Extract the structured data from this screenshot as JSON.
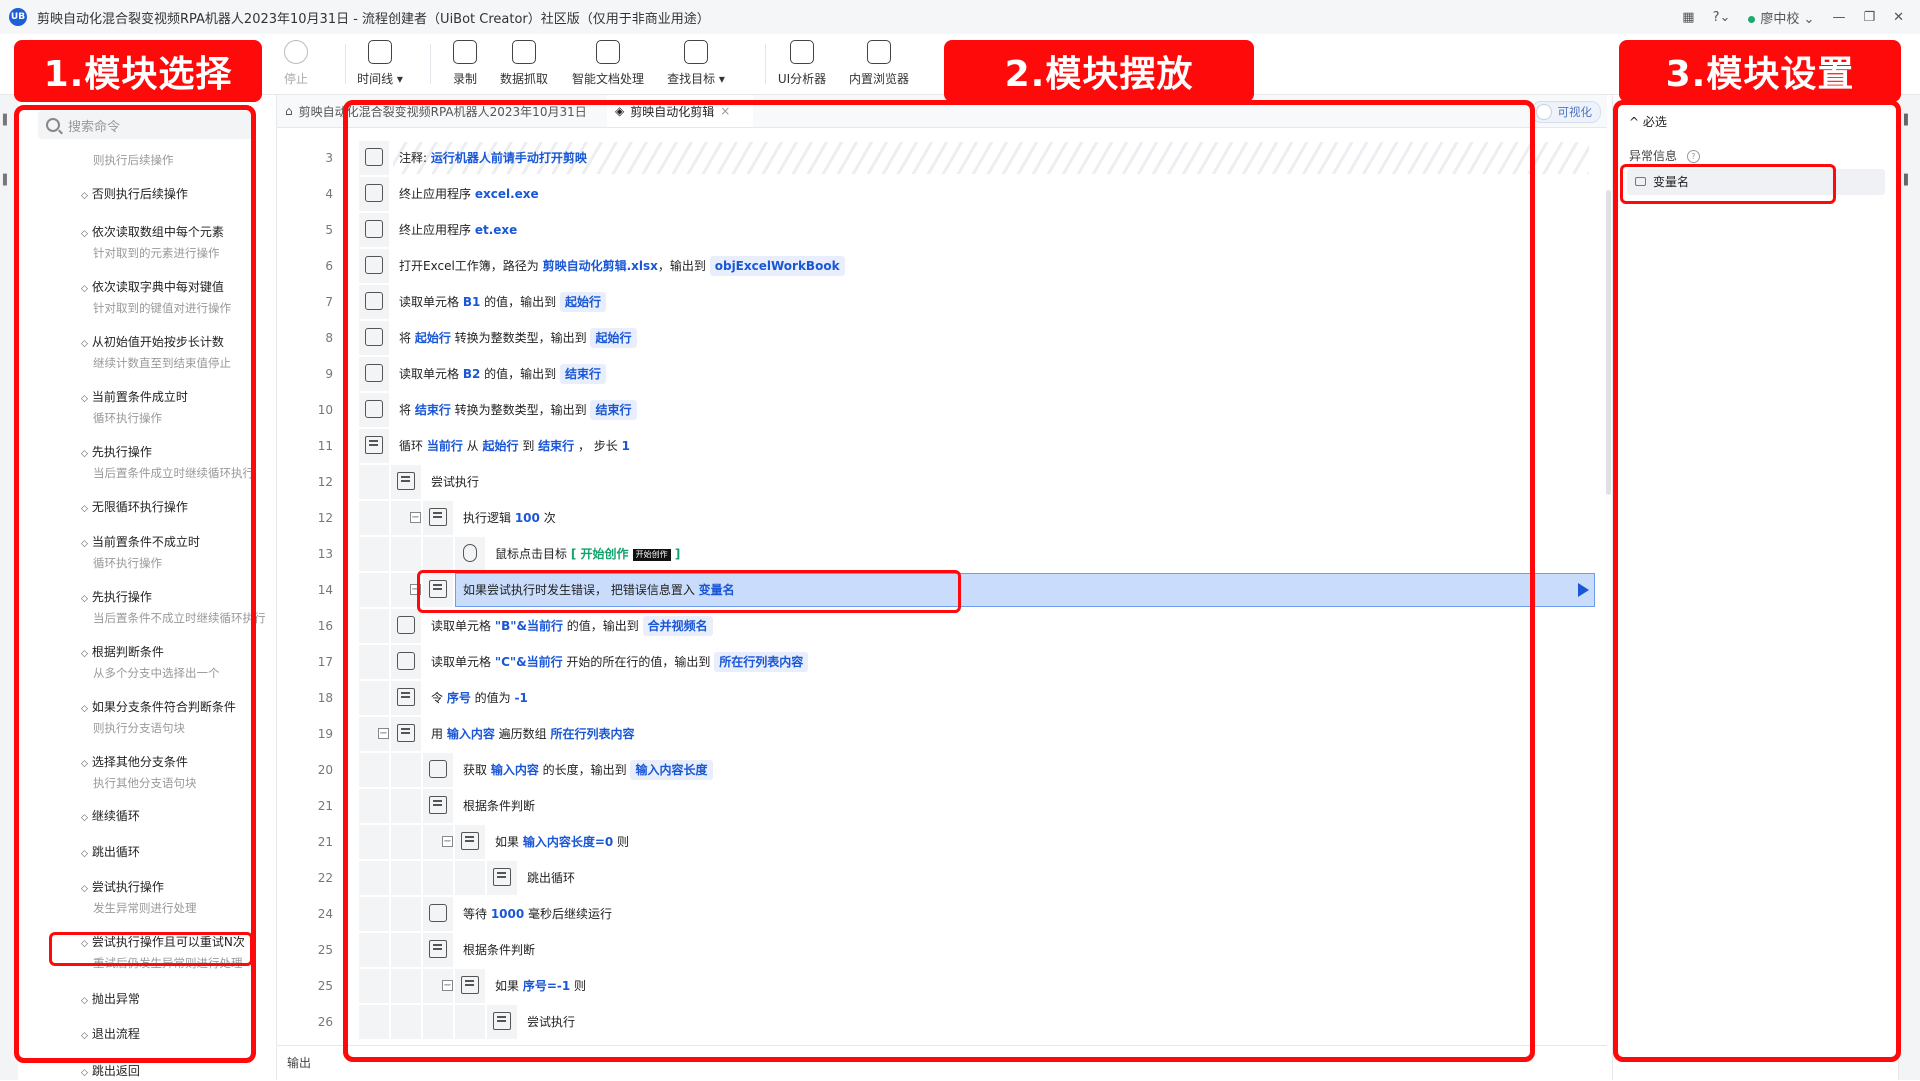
{
  "window": {
    "title": "剪映自动化混合裂变视频RPA机器人2023年10月31日 - 流程创建者（UiBot Creator）社区版（仅用于非商业用途）",
    "user": "廖中校",
    "logo_text": "UB"
  },
  "toolbar": [
    {
      "label": "停止",
      "icon": "stop-icon",
      "disabled": true
    },
    {
      "label": "时间线 ▾",
      "icon": "clock-icon"
    },
    {
      "label": "录制",
      "icon": "record-icon"
    },
    {
      "label": "数据抓取",
      "icon": "data-grab-icon"
    },
    {
      "label": "智能文档处理",
      "icon": "ai-doc-icon"
    },
    {
      "label": "查找目标 ▾",
      "icon": "find-target-icon"
    },
    {
      "label": "UI分析器",
      "icon": "ui-analyzer-icon"
    },
    {
      "label": "内置浏览器",
      "icon": "browser-icon"
    }
  ],
  "left": {
    "search_placeholder": "搜索命令",
    "commands": [
      {
        "name": "",
        "desc": "则执行后续操作"
      },
      {
        "name": "否则执行后续操作",
        "desc": ""
      },
      {
        "name": "依次读取数组中每个元素",
        "desc": "针对取到的元素进行操作"
      },
      {
        "name": "依次读取字典中每对键值",
        "desc": "针对取到的键值对进行操作"
      },
      {
        "name": "从初始值开始按步长计数",
        "desc": "继续计数直至到结束值停止"
      },
      {
        "name": "当前置条件成立时",
        "desc": "循环执行操作"
      },
      {
        "name": "先执行操作",
        "desc": "当后置条件成立时继续循环执行"
      },
      {
        "name": "无限循环执行操作",
        "desc": ""
      },
      {
        "name": "当前置条件不成立时",
        "desc": "循环执行操作"
      },
      {
        "name": "先执行操作",
        "desc": "当后置条件不成立时继续循环执行"
      },
      {
        "name": "根据判断条件",
        "desc": "从多个分支中选择出一个"
      },
      {
        "name": "如果分支条件符合判断条件",
        "desc": "则执行分支语句块"
      },
      {
        "name": "选择其他分支条件",
        "desc": "执行其他分支语句块"
      },
      {
        "name": "继续循环",
        "desc": ""
      },
      {
        "name": "跳出循环",
        "desc": ""
      },
      {
        "name": "尝试执行操作",
        "desc": "发生异常则进行处理"
      },
      {
        "name": "尝试执行操作且可以重试N次",
        "desc": "重试后仍发生异常则进行处理"
      },
      {
        "name": "抛出异常",
        "desc": ""
      },
      {
        "name": "退出流程",
        "desc": ""
      },
      {
        "name": "跳出返回",
        "desc": ""
      }
    ]
  },
  "editor": {
    "tabs": [
      "剪映自动化混合裂变视频RPA机器人2023年10月31日",
      "剪映自动化剪辑"
    ],
    "visual_toggle": "可视化",
    "output_label": "输出",
    "rows": [
      {
        "n": "3",
        "indent": 0,
        "icon": "code-icon",
        "segs": [
          [
            "t",
            "注释: "
          ],
          [
            "k",
            "运行机器人前请手动打开剪映"
          ]
        ],
        "hatch": true
      },
      {
        "n": "4",
        "indent": 0,
        "icon": "app-icon",
        "segs": [
          [
            "t",
            "终止应用程序 "
          ],
          [
            "k",
            "excel.exe"
          ]
        ]
      },
      {
        "n": "5",
        "indent": 0,
        "icon": "app-icon",
        "segs": [
          [
            "t",
            "终止应用程序 "
          ],
          [
            "k",
            "et.exe"
          ]
        ]
      },
      {
        "n": "6",
        "indent": 0,
        "icon": "excel-icon",
        "segs": [
          [
            "t",
            "打开Excel工作簿，路径为 "
          ],
          [
            "k",
            "剪映自动化剪辑.xlsx"
          ],
          [
            "t",
            "，输出到 "
          ],
          [
            "p",
            "objExcelWorkBook"
          ]
        ]
      },
      {
        "n": "7",
        "indent": 0,
        "icon": "excel-icon",
        "segs": [
          [
            "t",
            "读取单元格 "
          ],
          [
            "k",
            "B1"
          ],
          [
            "t",
            " 的值，输出到 "
          ],
          [
            "p",
            "起始行"
          ]
        ]
      },
      {
        "n": "8",
        "indent": 0,
        "icon": "code-icon",
        "segs": [
          [
            "t",
            "将 "
          ],
          [
            "k",
            "起始行"
          ],
          [
            "t",
            " 转换为整数类型，输出到 "
          ],
          [
            "p",
            "起始行"
          ]
        ]
      },
      {
        "n": "9",
        "indent": 0,
        "icon": "excel-icon",
        "segs": [
          [
            "t",
            "读取单元格 "
          ],
          [
            "k",
            "B2"
          ],
          [
            "t",
            " 的值，输出到 "
          ],
          [
            "p",
            "结束行"
          ]
        ]
      },
      {
        "n": "10",
        "indent": 0,
        "icon": "code-icon",
        "segs": [
          [
            "t",
            "将 "
          ],
          [
            "k",
            "结束行"
          ],
          [
            "t",
            " 转换为整数类型，输出到 "
          ],
          [
            "p",
            "结束行"
          ]
        ]
      },
      {
        "n": "11",
        "indent": 0,
        "icon": "loop-icon",
        "segs": [
          [
            "t",
            "循环 "
          ],
          [
            "k",
            "当前行"
          ],
          [
            "t",
            " 从 "
          ],
          [
            "k",
            "起始行"
          ],
          [
            "t",
            " 到 "
          ],
          [
            "k",
            "结束行"
          ],
          [
            "t",
            " ， 步长 "
          ],
          [
            "k",
            "1"
          ]
        ]
      },
      {
        "n": "12",
        "indent": 1,
        "icon": "loop-icon",
        "segs": [
          [
            "t",
            "尝试执行"
          ]
        ]
      },
      {
        "n": "12",
        "indent": 2,
        "icon": "loop-icon",
        "collapse": true,
        "segs": [
          [
            "t",
            "执行逻辑 "
          ],
          [
            "k",
            "100"
          ],
          [
            "t",
            " 次"
          ]
        ]
      },
      {
        "n": "13",
        "indent": 3,
        "icon": "mouse-icon",
        "segs": [
          [
            "t",
            "鼠标点击目标 "
          ],
          [
            "g",
            "[ 开始创作 "
          ],
          [
            "tag",
            "开始创作"
          ],
          [
            "g",
            " ]"
          ]
        ]
      },
      {
        "n": "14",
        "indent": 2,
        "icon": "loop-icon",
        "collapse": true,
        "highlight": true,
        "segs": [
          [
            "t",
            "如果尝试执行时发生错误， 把错误信息置入 "
          ],
          [
            "k",
            "变量名"
          ]
        ]
      },
      {
        "n": "16",
        "indent": 1,
        "icon": "excel-icon",
        "segs": [
          [
            "t",
            "读取单元格 "
          ],
          [
            "k",
            "\"B\"&当前行"
          ],
          [
            "t",
            " 的值，输出到 "
          ],
          [
            "p",
            "合并视频名"
          ]
        ]
      },
      {
        "n": "17",
        "indent": 1,
        "icon": "excel-icon",
        "segs": [
          [
            "t",
            "读取单元格 "
          ],
          [
            "k",
            "\"C\"&当前行"
          ],
          [
            "t",
            " 开始的所在行的值，输出到 "
          ],
          [
            "p",
            "所在行列表内容"
          ]
        ]
      },
      {
        "n": "18",
        "indent": 1,
        "icon": "loop-icon",
        "segs": [
          [
            "t",
            "令 "
          ],
          [
            "k",
            "序号"
          ],
          [
            "t",
            " 的值为 "
          ],
          [
            "k",
            "-1"
          ]
        ]
      },
      {
        "n": "19",
        "indent": 1,
        "icon": "loop-icon",
        "collapse": true,
        "segs": [
          [
            "t",
            "用 "
          ],
          [
            "k",
            "输入内容"
          ],
          [
            "t",
            " 遍历数组 "
          ],
          [
            "k",
            "所在行列表内容"
          ]
        ]
      },
      {
        "n": "20",
        "indent": 2,
        "icon": "code-icon",
        "segs": [
          [
            "t",
            "获取 "
          ],
          [
            "k",
            "输入内容"
          ],
          [
            "t",
            " 的长度，输出到 "
          ],
          [
            "p",
            "输入内容长度"
          ]
        ]
      },
      {
        "n": "21",
        "indent": 2,
        "icon": "loop-icon",
        "segs": [
          [
            "t",
            "根据条件判断"
          ]
        ]
      },
      {
        "n": "21",
        "indent": 3,
        "icon": "loop-icon",
        "collapse": true,
        "segs": [
          [
            "t",
            "如果 "
          ],
          [
            "k",
            "输入内容长度=0"
          ],
          [
            "t",
            " 则"
          ]
        ]
      },
      {
        "n": "22",
        "indent": 4,
        "icon": "loop-icon",
        "segs": [
          [
            "t",
            "跳出循环"
          ]
        ]
      },
      {
        "n": "24",
        "indent": 2,
        "icon": "code-icon",
        "segs": [
          [
            "t",
            "等待 "
          ],
          [
            "k",
            "1000"
          ],
          [
            "t",
            " 毫秒后继续运行"
          ]
        ]
      },
      {
        "n": "25",
        "indent": 2,
        "icon": "loop-icon",
        "segs": [
          [
            "t",
            "根据条件判断"
          ]
        ]
      },
      {
        "n": "25",
        "indent": 3,
        "icon": "loop-icon",
        "collapse": true,
        "segs": [
          [
            "t",
            "如果 "
          ],
          [
            "k",
            "序号=-1"
          ],
          [
            "t",
            " 则"
          ]
        ]
      },
      {
        "n": "26",
        "indent": 4,
        "icon": "loop-icon",
        "segs": [
          [
            "t",
            "尝试执行"
          ]
        ]
      }
    ]
  },
  "right": {
    "required_label": "^ 必选",
    "exception_label": "异常信息",
    "var_value": "变量名"
  },
  "annotations": {
    "label1": "1.模块选择",
    "label2": "2.模块摆放",
    "label3": "3.模块设置"
  },
  "colors": {
    "accent": "#1a57d6",
    "annotation_red": "#ff0a0a",
    "highlight": "#c9dcfb"
  }
}
